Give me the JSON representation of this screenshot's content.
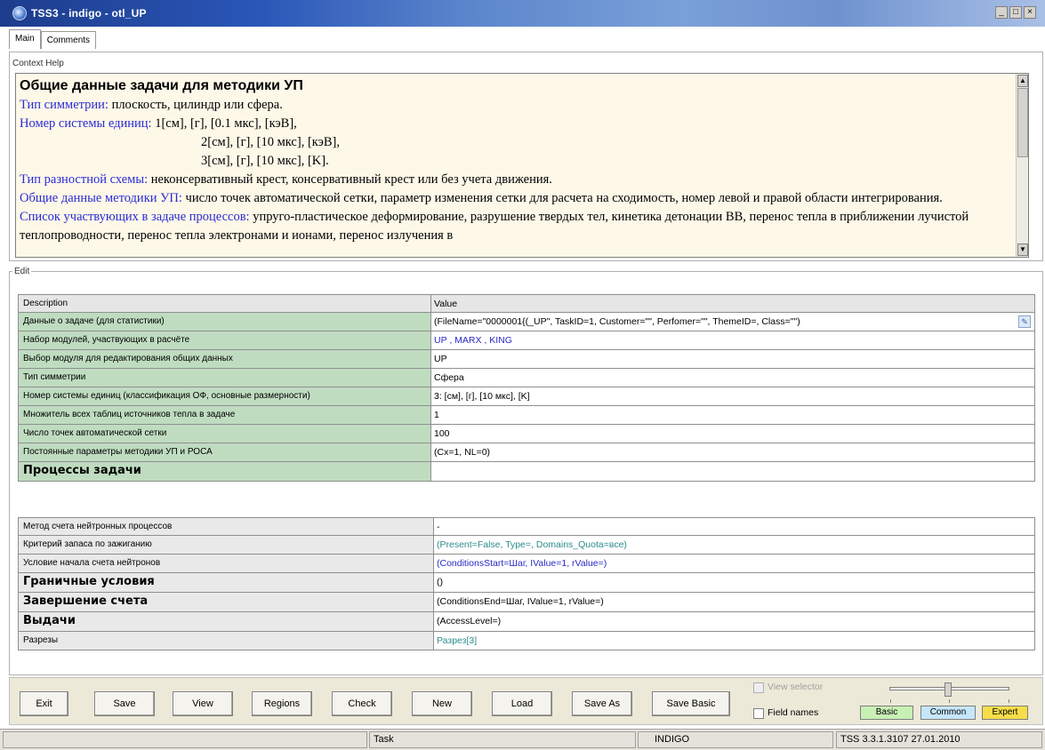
{
  "window": {
    "title": "TSS3 - indigo - otl_UP",
    "controls": [
      "_",
      "□",
      "×"
    ]
  },
  "tabs": [
    {
      "label": "Main",
      "active": true
    },
    {
      "label": "Comments",
      "active": false
    }
  ],
  "context_help": {
    "legend": "Context Help",
    "title": "Общие данные задачи для методики УП",
    "lines": [
      {
        "key": "Тип симметрии:",
        "text": " плоскость, цилиндр или сфера."
      },
      {
        "key": "Номер системы единиц:",
        "text": " 1[см], [г], [0.1 мкс], [кэВ],"
      },
      {
        "key": "",
        "text": "2[см], [г], [10 мкс],  [кэВ],"
      },
      {
        "key": "",
        "text": "3[см], [г], [10 мкс],  [K]."
      },
      {
        "key": "Тип разностной схемы:",
        "text": " неконсервативный крест, консервативный крест или без учета движения."
      },
      {
        "key": "Общие данные методики УП:",
        "text": " число точек автоматической сетки, параметр изменения сетки для расчета на сходимость, номер левой и правой области интегрирования."
      },
      {
        "key": "Список участвующих в задаче процессов:",
        "text": " упруго-пластическое деформирование, разрушение твердых тел, кинетика детонации ВВ, перенос тепла в приближении лучистой теплопроводности, перенос тепла электронами и ионами, перенос излучения в"
      }
    ]
  },
  "edit": {
    "legend": "Edit",
    "header": {
      "description": "Description",
      "value": "Value"
    },
    "rows_a": [
      {
        "description": "Данные о задаче (для статистики)",
        "value": "(FileName=\"0000001{(_UP\", TaskID=1, Customer=\"\", Perfomer=\"\", ThemeID=, Class=\"\")"
      },
      {
        "description": "Набор модулей, участвующих в расчёте",
        "value": "UP , MARX , KING"
      },
      {
        "description": "Выбор модуля для редактирования общих данных",
        "value": "UP"
      },
      {
        "description": "Тип симметрии",
        "value": "Сфера"
      },
      {
        "description": "Номер системы единиц (классификация ОФ, основные размерности)",
        "value": "3: [см], [г], [10 мкс], [K]"
      },
      {
        "description": "Множитель всех таблиц источников тепла в задаче",
        "value": "1"
      },
      {
        "description": "Число точек автоматической сетки",
        "value": "100"
      },
      {
        "description": "Постоянные параметры методики УП и РОСА",
        "value": "(Cx=1, NL=0)"
      },
      {
        "description": "Процессы задачи",
        "value": ""
      }
    ],
    "rows_b": [
      {
        "description": "Метод счета нейтронных процессов",
        "value": "-"
      },
      {
        "description": "Критерий запаса по зажиганию",
        "value": "(Present=False, Type=, Domains_Quota=все)"
      },
      {
        "description": "Условие начала счета нейтронов",
        "value": "(ConditionsStart=Шаг, IValue=1, rValue=)"
      },
      {
        "description": "Граничные условия",
        "value": "()"
      },
      {
        "description": "Завершение счета",
        "value": "(ConditionsEnd=Шаг, IValue=1, rValue=)"
      },
      {
        "description": "Выдачи",
        "value": "(AccessLevel=)"
      },
      {
        "description": "Разрезы",
        "value": "Разрез[3]"
      }
    ]
  },
  "toolbar": {
    "buttons": [
      "Exit",
      "Save",
      "View",
      "Regions",
      "Check",
      "New",
      "Load",
      "Save As",
      "Save Basic"
    ],
    "view_selector": "View selector",
    "field_names": "Field names",
    "levels": [
      "Basic",
      "Common",
      "Expert"
    ],
    "level_colors": [
      "#c8f0b4",
      "#c6e6fb",
      "#f8dd4a"
    ]
  },
  "statusbar": {
    "task": "Task",
    "server": "INDIGO",
    "version": "TSS 3.3.1.3107 27.01.2010"
  }
}
